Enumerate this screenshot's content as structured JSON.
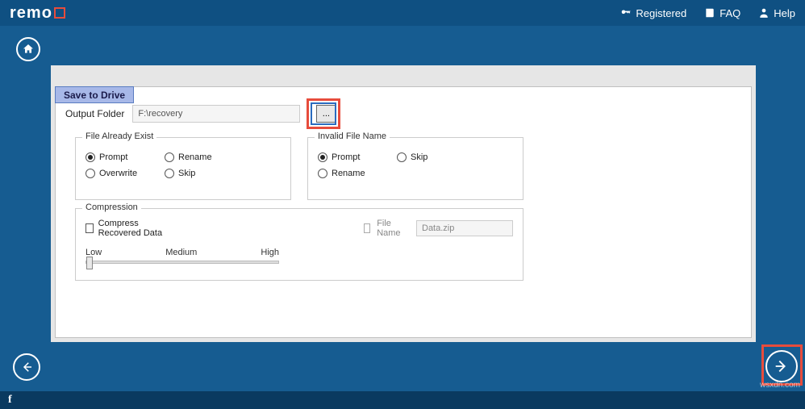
{
  "brand": "remo",
  "toplinks": {
    "registered": "Registered",
    "faq": "FAQ",
    "help": "Help"
  },
  "tab": "Save to Drive",
  "output": {
    "label": "Output Folder",
    "value": "F:\\recovery",
    "browse": "..."
  },
  "fae": {
    "title": "File Already Exist",
    "opts": {
      "prompt": "Prompt",
      "rename": "Rename",
      "overwrite": "Overwrite",
      "skip": "Skip"
    },
    "selected": "prompt"
  },
  "ifn": {
    "title": "Invalid File Name",
    "opts": {
      "prompt": "Prompt",
      "skip": "Skip",
      "rename": "Rename"
    },
    "selected": "prompt"
  },
  "comp": {
    "title": "Compression",
    "compress": "Compress Recovered Data",
    "filename_label": "File Name",
    "filename_value": "Data.zip",
    "low": "Low",
    "medium": "Medium",
    "high": "High"
  },
  "watermark": "wsxdn.com"
}
